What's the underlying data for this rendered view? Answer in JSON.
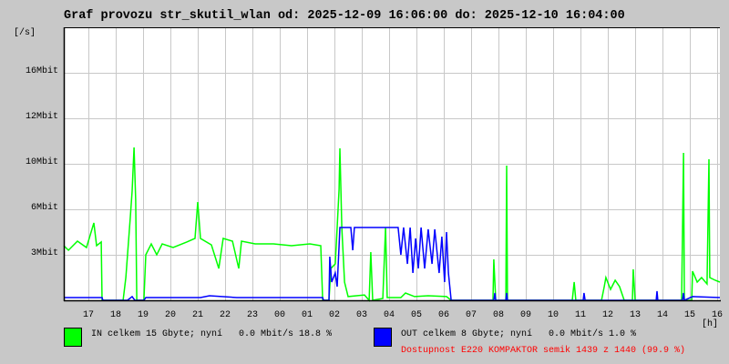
{
  "title": "Graf provozu str_skutil_wlan od: 2025-12-09 16:06:00 do: 2025-12-10 16:04:00",
  "colors": {
    "in": "#00ff00",
    "out": "#0000ff",
    "availability": "#ff0000",
    "grid": "#c8c8c8"
  },
  "legend": {
    "in": "IN celkem 15 Gbyte; nyní   0.0 Mbit/s 18.8 %",
    "out": "OUT celkem 8 Gbyte; nyní   0.0 Mbit/s 1.0 %",
    "availability": "Dostupnost E220 KOMPAKTOR semik 1439 z 1440 (99.9 %)"
  },
  "chart_data": {
    "type": "line",
    "title": "Graf provozu str_skutil_wlan od: 2025-12-09 16:06:00 do: 2025-12-10 16:04:00",
    "ylabel": "[/s]",
    "xlabel": "[h]",
    "x_unit": "hours since 16:06",
    "xlim": [
      0,
      24
    ],
    "ylim": [
      0,
      19.2
    ],
    "y_ticks": [
      {
        "value": 3.2,
        "label": "3Mbit"
      },
      {
        "value": 6.4,
        "label": "6Mbit"
      },
      {
        "value": 9.6,
        "label": "10Mbit"
      },
      {
        "value": 12.8,
        "label": "12Mbit"
      },
      {
        "value": 16,
        "label": "16Mbit"
      }
    ],
    "x_ticks": [
      {
        "value": 0.9,
        "label": "17"
      },
      {
        "value": 1.9,
        "label": "18"
      },
      {
        "value": 2.9,
        "label": "19"
      },
      {
        "value": 3.9,
        "label": "20"
      },
      {
        "value": 4.9,
        "label": "21"
      },
      {
        "value": 5.9,
        "label": "22"
      },
      {
        "value": 6.9,
        "label": "23"
      },
      {
        "value": 7.9,
        "label": "00"
      },
      {
        "value": 8.9,
        "label": "01"
      },
      {
        "value": 9.9,
        "label": "02"
      },
      {
        "value": 10.9,
        "label": "03"
      },
      {
        "value": 11.9,
        "label": "04"
      },
      {
        "value": 12.9,
        "label": "05"
      },
      {
        "value": 13.9,
        "label": "06"
      },
      {
        "value": 14.9,
        "label": "07"
      },
      {
        "value": 15.9,
        "label": "08"
      },
      {
        "value": 16.9,
        "label": "09"
      },
      {
        "value": 17.9,
        "label": "10"
      },
      {
        "value": 18.9,
        "label": "11"
      },
      {
        "value": 19.9,
        "label": "12"
      },
      {
        "value": 20.9,
        "label": "13"
      },
      {
        "value": 21.9,
        "label": "14"
      },
      {
        "value": 22.9,
        "label": "15"
      },
      {
        "value": 23.9,
        "label": "16"
      }
    ],
    "grid": true,
    "series": [
      {
        "name": "IN",
        "unit": "Mbit/s",
        "points": [
          [
            0,
            3.84
          ],
          [
            0.17,
            3.52
          ],
          [
            0.5,
            4.16
          ],
          [
            0.83,
            3.71
          ],
          [
            1.1,
            5.44
          ],
          [
            1.2,
            3.84
          ],
          [
            1.37,
            4.1
          ],
          [
            1.4,
            0
          ],
          [
            2.17,
            0
          ],
          [
            2.27,
            1.6
          ],
          [
            2.43,
            5.76
          ],
          [
            2.5,
            7.68
          ],
          [
            2.57,
            10.75
          ],
          [
            2.63,
            7.04
          ],
          [
            2.67,
            0
          ],
          [
            2.93,
            0
          ],
          [
            3.0,
            3.2
          ],
          [
            3.2,
            3.97
          ],
          [
            3.4,
            3.2
          ],
          [
            3.6,
            3.97
          ],
          [
            4.0,
            3.71
          ],
          [
            4.5,
            4.1
          ],
          [
            4.8,
            4.35
          ],
          [
            4.9,
            6.91
          ],
          [
            5.0,
            4.35
          ],
          [
            5.4,
            3.9
          ],
          [
            5.67,
            2.24
          ],
          [
            5.83,
            4.35
          ],
          [
            6.17,
            4.16
          ],
          [
            6.4,
            2.24
          ],
          [
            6.5,
            4.16
          ],
          [
            7.0,
            3.97
          ],
          [
            7.67,
            3.97
          ],
          [
            8.33,
            3.84
          ],
          [
            9.0,
            3.97
          ],
          [
            9.4,
            3.84
          ],
          [
            9.47,
            0
          ],
          [
            9.7,
            0
          ],
          [
            9.77,
            2.24
          ],
          [
            9.93,
            2.56
          ],
          [
            10.0,
            5.12
          ],
          [
            10.07,
            7.81
          ],
          [
            10.1,
            10.69
          ],
          [
            10.17,
            5.12
          ],
          [
            10.27,
            1.28
          ],
          [
            10.4,
            0.26
          ],
          [
            11.0,
            0.38
          ],
          [
            11.17,
            0
          ],
          [
            11.23,
            3.39
          ],
          [
            11.3,
            0
          ],
          [
            11.67,
            0.13
          ],
          [
            11.77,
            5.12
          ],
          [
            11.83,
            0.19
          ],
          [
            12.33,
            0.19
          ],
          [
            12.5,
            0.51
          ],
          [
            12.83,
            0.26
          ],
          [
            13.33,
            0.32
          ],
          [
            14.0,
            0.26
          ],
          [
            14.17,
            0
          ],
          [
            15.7,
            0
          ],
          [
            15.73,
            2.88
          ],
          [
            15.8,
            0
          ],
          [
            16.17,
            0
          ],
          [
            16.2,
            9.47
          ],
          [
            16.23,
            0
          ],
          [
            18.6,
            0
          ],
          [
            18.67,
            1.28
          ],
          [
            18.73,
            0
          ],
          [
            19.67,
            0
          ],
          [
            19.77,
            0.96
          ],
          [
            19.83,
            1.6
          ],
          [
            20.0,
            0.77
          ],
          [
            20.17,
            1.41
          ],
          [
            20.33,
            0.96
          ],
          [
            20.5,
            0
          ],
          [
            20.8,
            0
          ],
          [
            20.83,
            2.18
          ],
          [
            20.9,
            0
          ],
          [
            22.6,
            0
          ],
          [
            22.67,
            10.37
          ],
          [
            22.7,
            0
          ],
          [
            22.97,
            0
          ],
          [
            23.0,
            2.05
          ],
          [
            23.17,
            1.28
          ],
          [
            23.33,
            1.6
          ],
          [
            23.53,
            1.15
          ],
          [
            23.6,
            9.92
          ],
          [
            23.63,
            1.6
          ],
          [
            23.83,
            1.41
          ],
          [
            24.0,
            1.28
          ]
        ]
      },
      {
        "name": "OUT",
        "unit": "Mbit/s",
        "points": [
          [
            0,
            0.19
          ],
          [
            1.4,
            0.19
          ],
          [
            1.43,
            0
          ],
          [
            2.33,
            0
          ],
          [
            2.5,
            0.26
          ],
          [
            2.6,
            0
          ],
          [
            2.93,
            0
          ],
          [
            3.0,
            0.19
          ],
          [
            5.0,
            0.19
          ],
          [
            5.33,
            0.32
          ],
          [
            6.33,
            0.19
          ],
          [
            9.47,
            0.19
          ],
          [
            9.5,
            0
          ],
          [
            9.7,
            0
          ],
          [
            9.73,
            3.07
          ],
          [
            9.8,
            1.28
          ],
          [
            9.93,
            1.92
          ],
          [
            10.0,
            0.96
          ],
          [
            10.07,
            3.84
          ],
          [
            10.1,
            5.12
          ],
          [
            10.5,
            5.12
          ],
          [
            10.57,
            3.52
          ],
          [
            10.63,
            5.12
          ],
          [
            12.23,
            5.12
          ],
          [
            12.33,
            3.2
          ],
          [
            12.43,
            5.12
          ],
          [
            12.57,
            2.56
          ],
          [
            12.67,
            5.12
          ],
          [
            12.77,
            1.92
          ],
          [
            12.87,
            4.35
          ],
          [
            12.97,
            2.24
          ],
          [
            13.07,
            5.12
          ],
          [
            13.2,
            2.24
          ],
          [
            13.33,
            4.99
          ],
          [
            13.47,
            2.56
          ],
          [
            13.57,
            4.99
          ],
          [
            13.73,
            1.92
          ],
          [
            13.83,
            4.48
          ],
          [
            13.93,
            1.28
          ],
          [
            14.0,
            4.8
          ],
          [
            14.07,
            1.92
          ],
          [
            14.17,
            0
          ],
          [
            15.73,
            0
          ],
          [
            15.77,
            0.51
          ],
          [
            15.8,
            0
          ],
          [
            16.17,
            0
          ],
          [
            16.2,
            0.51
          ],
          [
            16.23,
            0
          ],
          [
            19.0,
            0
          ],
          [
            19.03,
            0.51
          ],
          [
            19.07,
            0
          ],
          [
            21.67,
            0
          ],
          [
            21.7,
            0.64
          ],
          [
            21.73,
            0
          ],
          [
            22.63,
            0
          ],
          [
            22.67,
            0.51
          ],
          [
            22.7,
            0
          ],
          [
            23.0,
            0.26
          ],
          [
            24.0,
            0.19
          ]
        ]
      }
    ]
  }
}
